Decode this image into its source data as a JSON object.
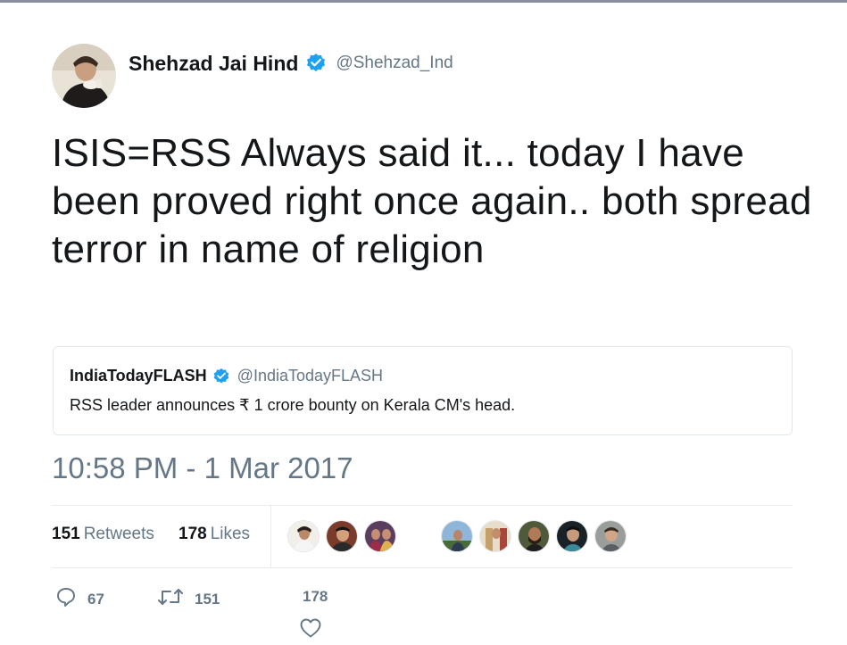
{
  "tweet": {
    "author_name": "Shehzad Jai Hind",
    "author_handle": "@Shehzad_Ind",
    "text": "ISIS=RSS Always said it... today I have been proved right once again.. both spread terror in name of religion",
    "timestamp": "10:58 PM - 1 Mar 2017"
  },
  "quoted_tweet": {
    "author_name": "IndiaTodayFLASH",
    "author_handle": "@IndiaTodayFLASH",
    "text": "RSS leader announces ₹ 1 crore bounty on Kerala CM's head."
  },
  "stats": {
    "retweets_count": "151",
    "retweets_label": "Retweets",
    "likes_count": "178",
    "likes_label": "Likes"
  },
  "actions": {
    "reply_count": "67",
    "retweet_count": "151",
    "like_count": "178"
  },
  "colors": {
    "verified": "#1da1f2",
    "text": "#14171a",
    "muted": "#657786",
    "border": "#e1e8ed"
  },
  "icons": [
    "verified-badge-icon",
    "reply-icon",
    "retweet-icon",
    "heart-icon"
  ]
}
